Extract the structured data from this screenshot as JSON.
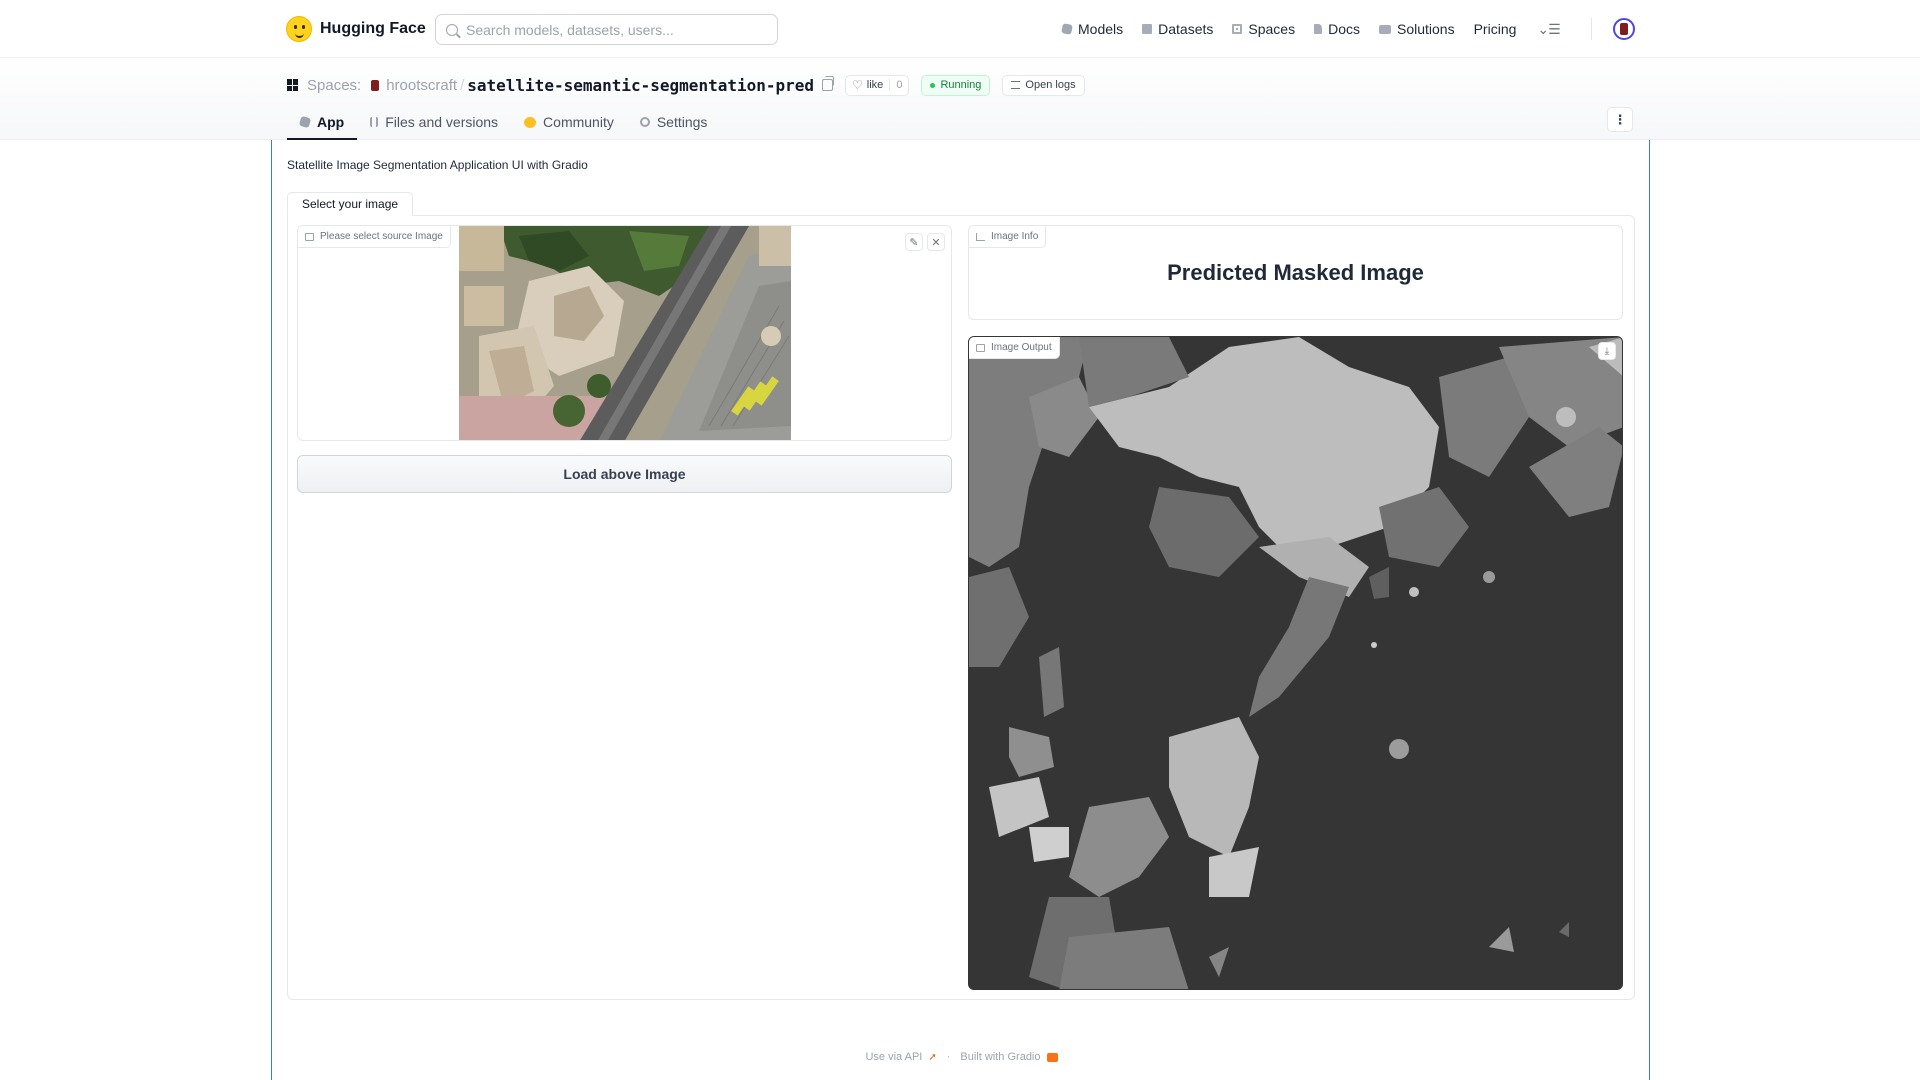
{
  "navbar": {
    "brand": "Hugging Face",
    "search_placeholder": "Search models, datasets, users...",
    "links": {
      "models": "Models",
      "datasets": "Datasets",
      "spaces": "Spaces",
      "docs": "Docs",
      "solutions": "Solutions",
      "pricing": "Pricing"
    }
  },
  "space": {
    "spaces_label": "Spaces:",
    "owner": "hrootscraft",
    "separator": "/",
    "repo": "satellite-semantic-segmentation-pred",
    "like_label": "like",
    "like_count": "0",
    "status": "Running",
    "logs_label": "Open logs",
    "status_color": "#15803d"
  },
  "tabs": {
    "app": "App",
    "files": "Files and versions",
    "community": "Community",
    "settings": "Settings"
  },
  "app": {
    "description": "Statellite Image Segmentation Application UI with Gradio",
    "tab_label": "Select your image",
    "source_label": "Please select source Image",
    "load_button": "Load above Image",
    "info_label": "Image Info",
    "info_title": "Predicted Masked Image",
    "output_label": "Image Output"
  },
  "footer": {
    "api": "Use via API",
    "dot": "·",
    "built": "Built with Gradio"
  }
}
